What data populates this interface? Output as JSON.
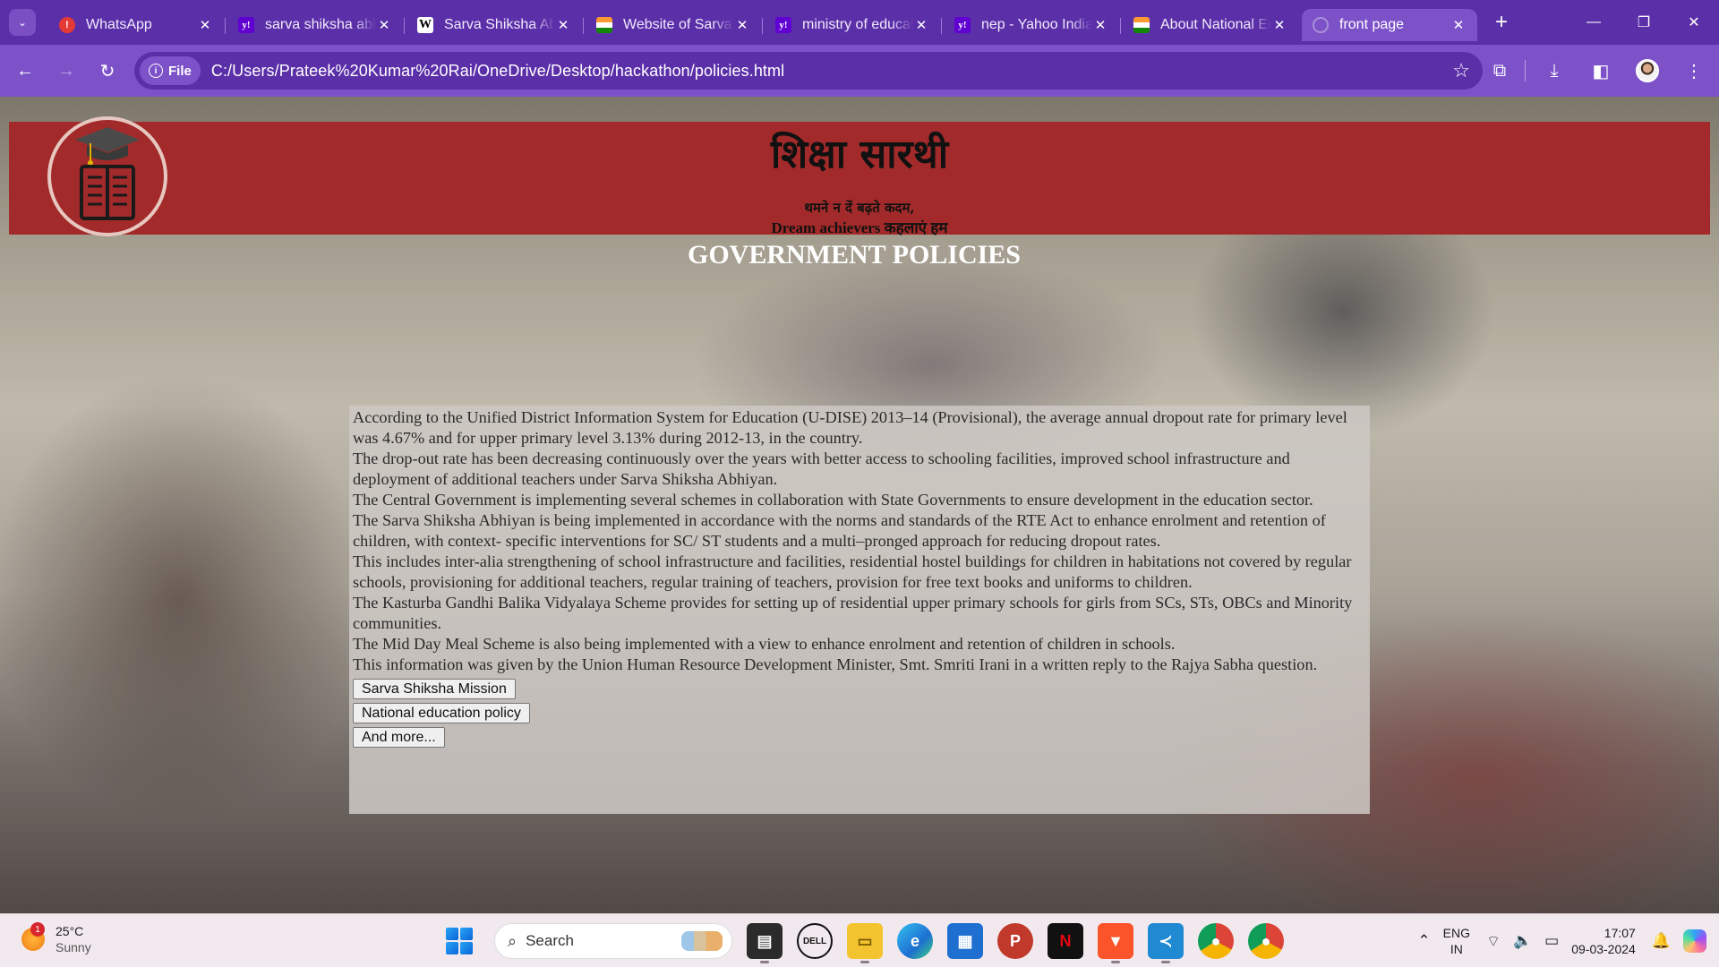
{
  "browser": {
    "tabs": [
      {
        "title": "WhatsApp",
        "favicon": "whatsapp-icon",
        "active": false
      },
      {
        "title": "sarva shiksha abhiyan - Yahoo",
        "favicon": "yahoo-icon",
        "active": false
      },
      {
        "title": "Sarva Shiksha Abhiyan - Wikipedia",
        "favicon": "wikipedia-icon",
        "active": false
      },
      {
        "title": "Website of Sarva Shiksha",
        "favicon": "india-flag-icon",
        "active": false
      },
      {
        "title": "ministry of education - Yahoo",
        "favicon": "yahoo-icon",
        "active": false
      },
      {
        "title": "nep - Yahoo India Search",
        "favicon": "yahoo-icon",
        "active": false
      },
      {
        "title": "About National Education",
        "favicon": "india-flag-icon",
        "active": false
      },
      {
        "title": "front page",
        "favicon": "globe-icon",
        "active": true
      }
    ],
    "scheme_label": "File",
    "url": "C:/Users/Prateek%20Kumar%20Rai/OneDrive/Desktop/hackathon/policies.html"
  },
  "header": {
    "title": "शिक्षा सारथी",
    "tagline_line1": "थमने न दें बढ़ते कदम,",
    "tagline_line2": "Dream achievers कहलाएं हम",
    "logo_icon": "graduation-book-icon",
    "bg_color": "#a32a2a"
  },
  "section": {
    "title": "GOVERNMENT POLICIES"
  },
  "content": {
    "paragraphs": [
      "According to the Unified District Information System for Education (U-DISE) 2013–14 (Provisional), the average annual dropout rate for primary level was 4.67% and for upper primary level 3.13% during 2012-13, in the country.",
      "The drop-out rate has been decreasing continuously over the years with better access to schooling facilities, improved school infrastructure and deployment of additional teachers under Sarva Shiksha Abhiyan.",
      "The Central Government is implementing several schemes in collaboration with State Governments to ensure development in the education sector.",
      "The Sarva Shiksha Abhiyan is being implemented in accordance with the norms and standards of the RTE Act to enhance enrolment and retention of children, with context- specific interventions for SC/ ST students and a multi–pronged approach for reducing dropout rates.",
      "This includes inter-alia strengthening of school infrastructure and facilities, residential hostel buildings for children in habitations not covered by regular schools, provisioning for additional teachers, regular training of teachers, provision for free text books and uniforms to children.",
      "The Kasturba Gandhi Balika Vidyalaya Scheme provides for setting up of residential upper primary schools for girls from SCs, STs, OBCs and Minority communities.",
      "The Mid Day Meal Scheme is also being implemented with a view to enhance enrolment and retention of children in schools.",
      "This information was given by the Union Human Resource Development Minister, Smt. Smriti Irani in a written reply to the Rajya Sabha question."
    ],
    "buttons": [
      "Sarva Shiksha Mission",
      "National education policy",
      "And more..."
    ]
  },
  "taskbar": {
    "weather_temp": "25°C",
    "weather_desc": "Sunny",
    "weather_badge": "1",
    "search_placeholder": "Search",
    "lang_line1": "ENG",
    "lang_line2": "IN",
    "time": "17:07",
    "date": "09-03-2024",
    "apps": [
      "task-view-icon",
      "dell-icon",
      "file-explorer-icon",
      "edge-icon",
      "microsoft-store-icon",
      "powerpoint-icon",
      "netflix-icon",
      "brave-icon",
      "vscode-icon",
      "chrome-icon",
      "chrome-profile-icon"
    ]
  }
}
